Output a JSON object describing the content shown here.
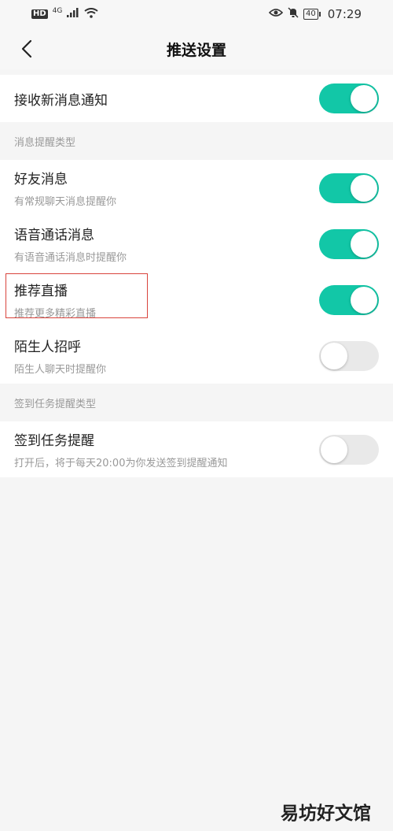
{
  "status_bar": {
    "hd": "HD",
    "network": "4G",
    "battery": "40",
    "time": "07:29"
  },
  "nav": {
    "title": "推送设置",
    "back_icon": "chevron-left-icon"
  },
  "main_toggle": {
    "title": "接收新消息通知",
    "on": true
  },
  "group1": {
    "label": "消息提醒类型",
    "items": [
      {
        "title": "好友消息",
        "subtitle": "有常规聊天消息提醒你",
        "on": true
      },
      {
        "title": "语音通话消息",
        "subtitle": "有语音通话消息时提醒你",
        "on": true
      },
      {
        "title": "推荐直播",
        "subtitle": "推荐更多精彩直播",
        "on": true
      },
      {
        "title": "陌生人招呼",
        "subtitle": "陌生人聊天时提醒你",
        "on": false
      }
    ]
  },
  "group2": {
    "label": "签到任务提醒类型",
    "items": [
      {
        "title": "签到任务提醒",
        "subtitle": "打开后，将于每天20:00为你发送签到提醒通知",
        "on": false
      }
    ]
  },
  "watermark": "易坊好文馆",
  "colors": {
    "toggle_on": "#12c7a7",
    "toggle_off": "#e9e9e9",
    "highlight": "#d9443d"
  }
}
